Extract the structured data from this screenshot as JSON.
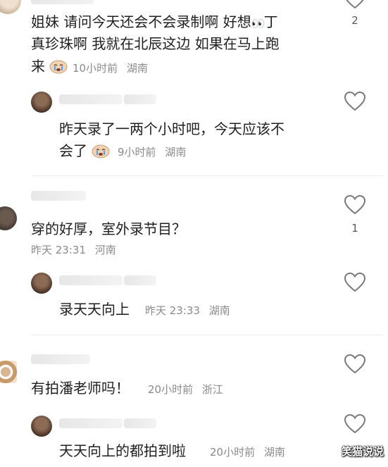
{
  "comments": [
    {
      "text_line1": "姐妹 请问今天还会不会录制啊 好想",
      "text_line1b": "丁",
      "text_line2": "真珍珠啊  我就在北辰这边 如果在马上跑",
      "text_line3": "来",
      "time": "10小时前",
      "location": "湖南",
      "like_count": "2",
      "reply": {
        "text_line1": "昨天录了一两个小时吧，今天应该不",
        "text_line2": "会了",
        "time": "9小时前",
        "location": "湖南"
      }
    },
    {
      "text": "穿的好厚，室外录节目？",
      "time": "昨天 23:31",
      "location": "河南",
      "like_count": "1",
      "reply": {
        "text": "录天天向上",
        "time": "昨天 23:33",
        "location": "湖南"
      }
    },
    {
      "text": "有拍潘老师吗！",
      "time": "20小时前",
      "location": "浙江",
      "reply": {
        "text": "天天向上的都拍到啦",
        "time": "20小时前",
        "location": "湖南"
      }
    }
  ],
  "watermark": "笑猫说说",
  "icons": {
    "like": "heart-outline-icon",
    "emoji_eyes": "eyes-emoji-icon",
    "emoji_cry": "crying-face-emoji-icon"
  },
  "colors": {
    "text": "#1f1f1f",
    "meta": "#8a8a8a",
    "divider": "#ededed"
  }
}
